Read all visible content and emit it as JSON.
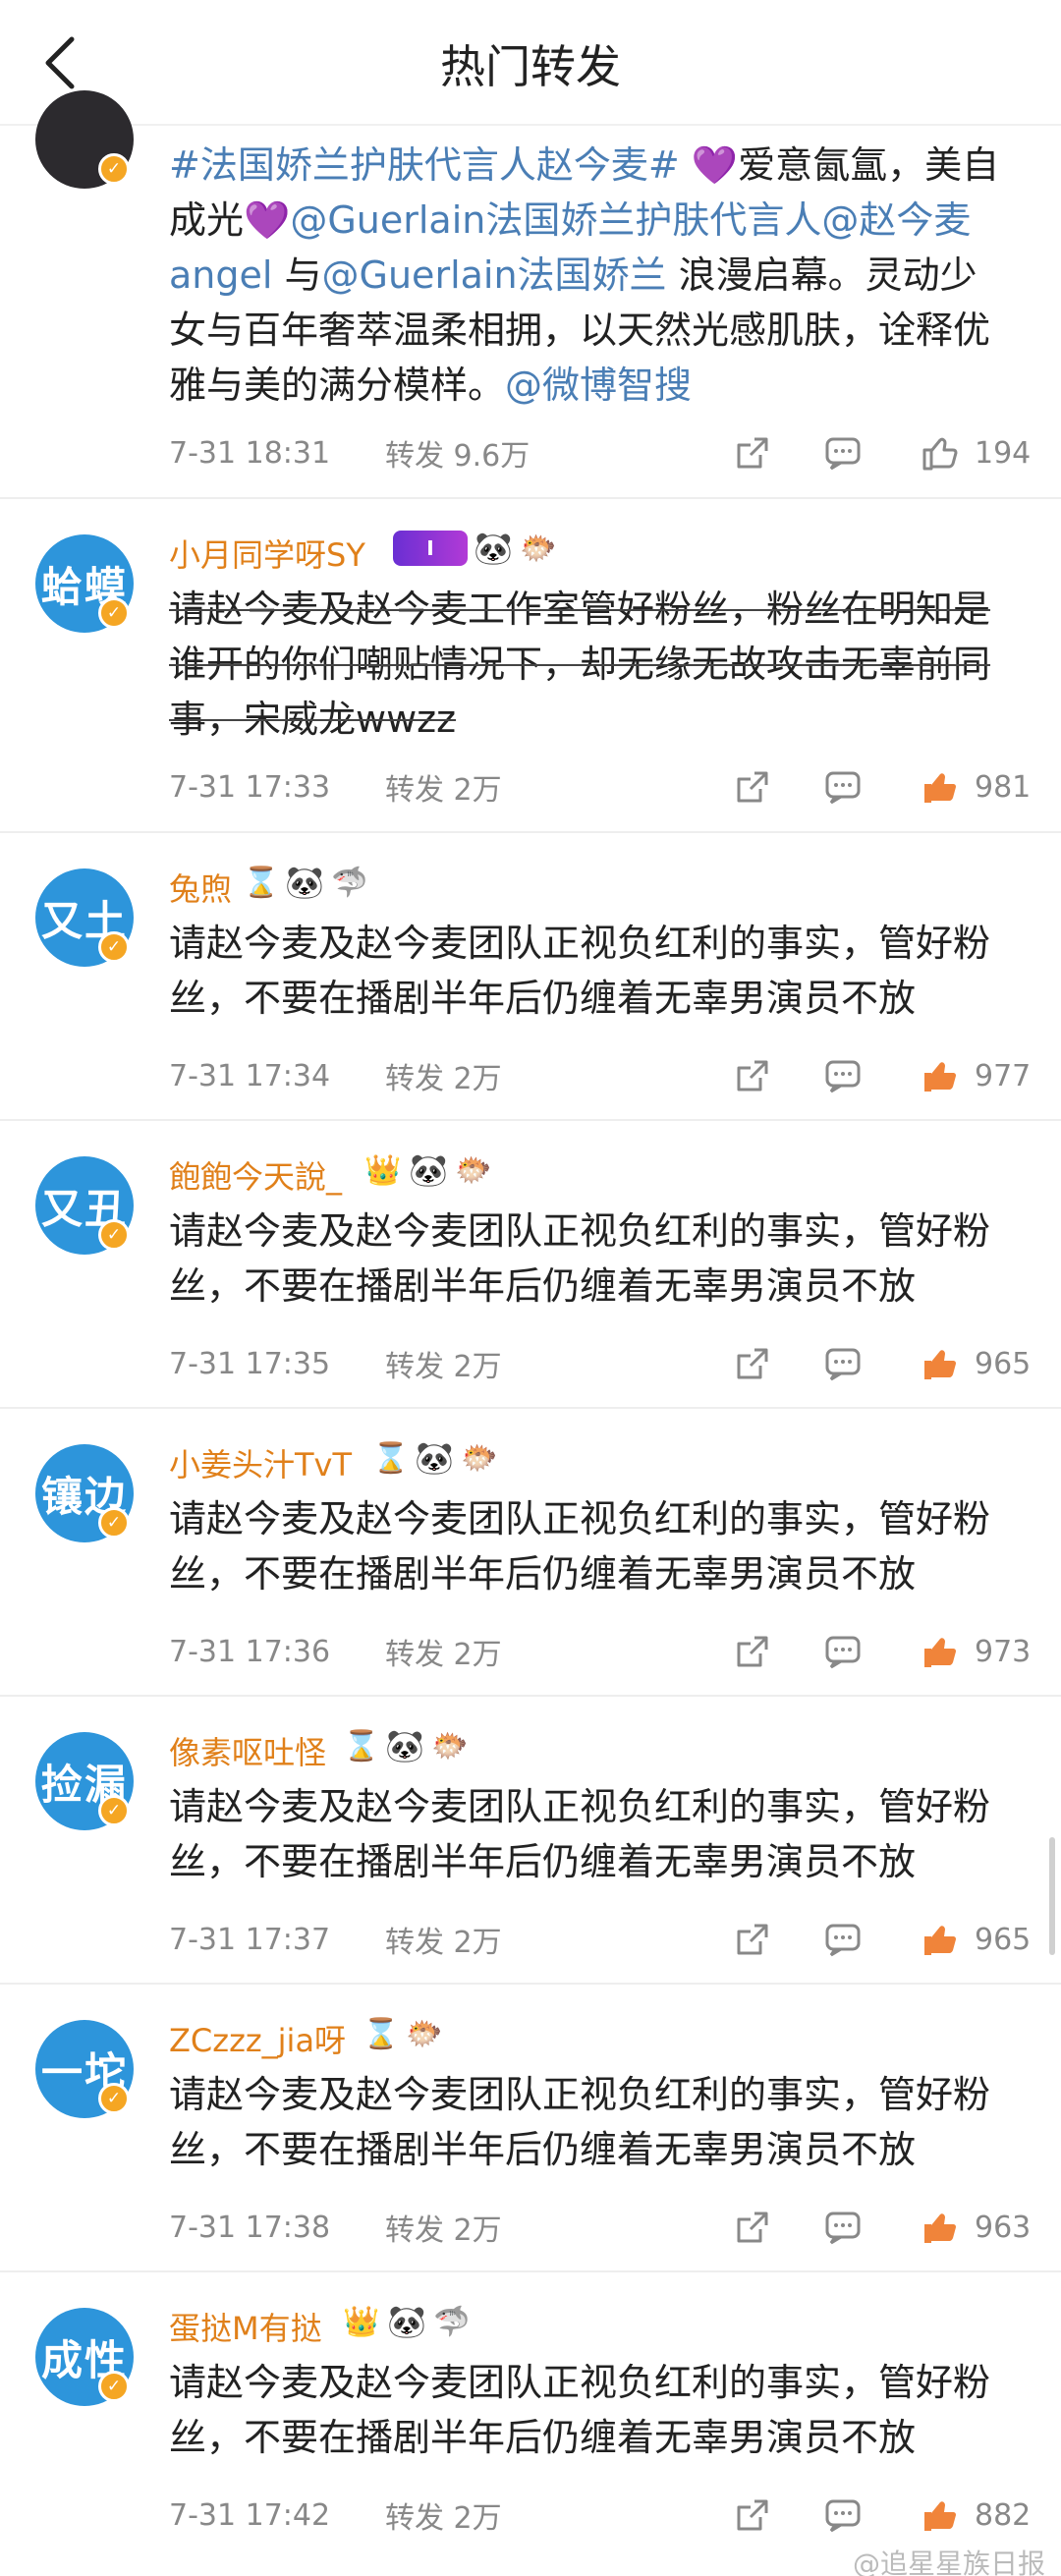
{
  "header": {
    "title": "热门转发"
  },
  "first_post": {
    "text_parts": [
      "#法国娇兰护肤代言人赵今麦#",
      " 💜爱意氤氲，美自成光💜",
      "@Guerlain法国娇兰护肤代言人@赵今麦angel",
      " 与",
      "@Guerlain法国娇兰",
      " 浪漫启幕。灵动少女与百年奢萃温柔相拥，以天然光感肌肤，诠释优雅与美的满分模样。",
      "@微博智搜"
    ],
    "time": "7-31 18:31",
    "forward": "转发 9.6万",
    "likes": "194"
  },
  "posts": [
    {
      "avatar": "蛤蟆",
      "name": "小月同学呀SY",
      "text": "请赵今麦及赵今麦工作室管好粉丝，粉丝在明知是谁开的你们嘲贴情况下，却无缘无故攻击无辜前同事，宋威龙wwzz",
      "time": "7-31 17:33",
      "forward": "转发 2万",
      "likes": "981",
      "icons": [
        "level-badge",
        "panda-icon",
        "pufferfish-icon"
      ],
      "level": "I"
    },
    {
      "avatar": "又土",
      "name": "兔煦",
      "text": "请赵今麦及赵今麦团队正视负红利的事实，管好粉丝，不要在播剧半年后仍缠着无辜男演员不放",
      "time": "7-31 17:34",
      "forward": "转发 2万",
      "likes": "977",
      "icons": [
        "hourglass-icon",
        "panda-icon",
        "fish-icon"
      ]
    },
    {
      "avatar": "又丑",
      "name": "飽飽今天說_",
      "text": "请赵今麦及赵今麦团队正视负红利的事实，管好粉丝，不要在播剧半年后仍缠着无辜男演员不放",
      "time": "7-31 17:35",
      "forward": "转发 2万",
      "likes": "965",
      "icons": [
        "crown-icon",
        "panda-icon",
        "pufferfish-icon"
      ]
    },
    {
      "avatar": "镶边",
      "name": "小姜头汁TvT",
      "text": "请赵今麦及赵今麦团队正视负红利的事实，管好粉丝，不要在播剧半年后仍缠着无辜男演员不放",
      "time": "7-31 17:36",
      "forward": "转发 2万",
      "likes": "973",
      "icons": [
        "hourglass-icon",
        "panda-icon",
        "pufferfish-icon"
      ]
    },
    {
      "avatar": "捡漏",
      "name": "像素呕吐怪",
      "text": "请赵今麦及赵今麦团队正视负红利的事实，管好粉丝，不要在播剧半年后仍缠着无辜男演员不放",
      "time": "7-31 17:37",
      "forward": "转发 2万",
      "likes": "965",
      "icons": [
        "hourglass-icon",
        "panda-icon",
        "pufferfish-icon"
      ]
    },
    {
      "avatar": "一坨",
      "name": "ZCzzz_jia呀",
      "text": "请赵今麦及赵今麦团队正视负红利的事实，管好粉丝，不要在播剧半年后仍缠着无辜男演员不放",
      "time": "7-31 17:38",
      "forward": "转发 2万",
      "likes": "963",
      "icons": [
        "hourglass-icon",
        "pufferfish-icon"
      ]
    },
    {
      "avatar": "成性",
      "name": "蛋挞M有挞",
      "text": "请赵今麦及赵今麦团队正视负红利的事实，管好粉丝，不要在播剧半年后仍缠着无辜男演员不放",
      "time": "7-31 17:42",
      "forward": "转发 2万",
      "likes": "882",
      "icons": [
        "crown-icon",
        "panda-icon",
        "fish-icon"
      ]
    }
  ],
  "watermark": "@追星星族日报",
  "colors": {
    "username": "#e0801a",
    "link": "#4a7eb5",
    "avatar": "#2d95db",
    "verified": "#f5a623",
    "like_active": "#f0843a"
  }
}
